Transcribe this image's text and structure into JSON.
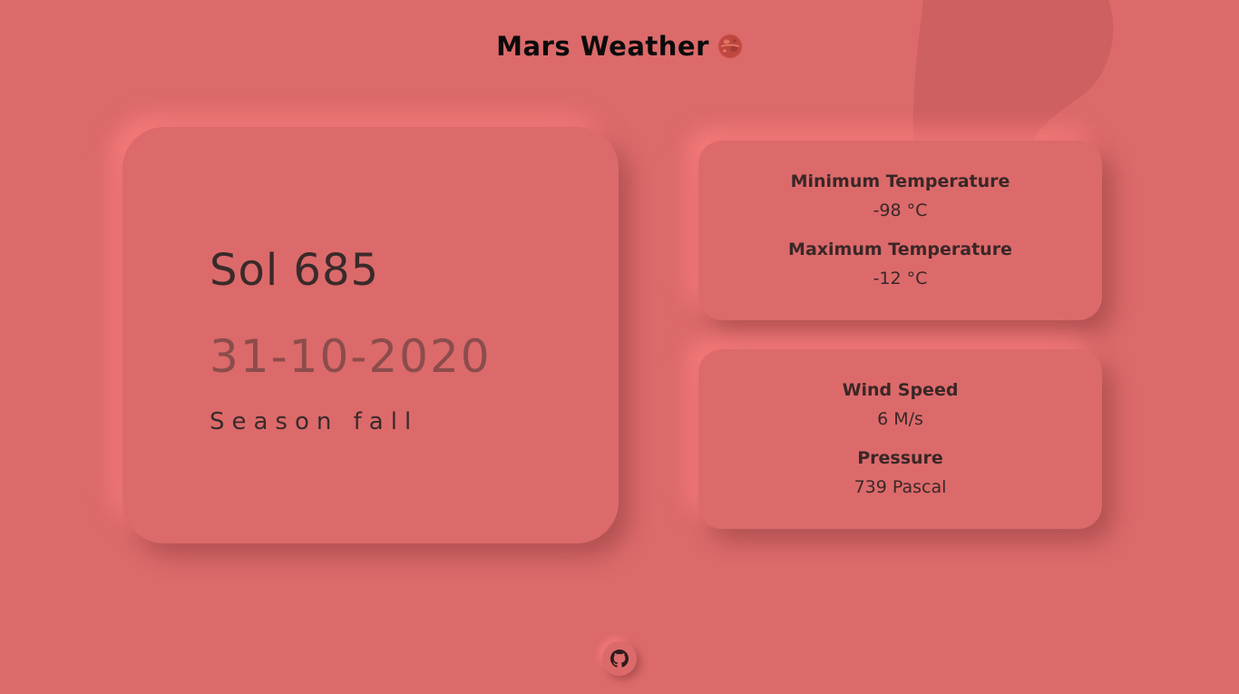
{
  "header": {
    "title": "Mars Weather",
    "icon": "mars-planet-icon"
  },
  "sol_card": {
    "sol": "Sol 685",
    "date": "31-10-2020",
    "season": "Season fall"
  },
  "temperature_card": {
    "min_label": "Minimum Temperature",
    "min_value": "-98 °C",
    "max_label": "Maximum Temperature",
    "max_value": "-12 °C"
  },
  "wind_card": {
    "wind_label": "Wind Speed",
    "wind_value": "6 M/s",
    "pressure_label": "Pressure",
    "pressure_value": "739 Pascal"
  },
  "footer": {
    "github_icon": "github-icon"
  },
  "colors": {
    "background": "#dc6a6b",
    "text_dark": "#3a2a2a",
    "date_text": "#8c4c4c"
  }
}
